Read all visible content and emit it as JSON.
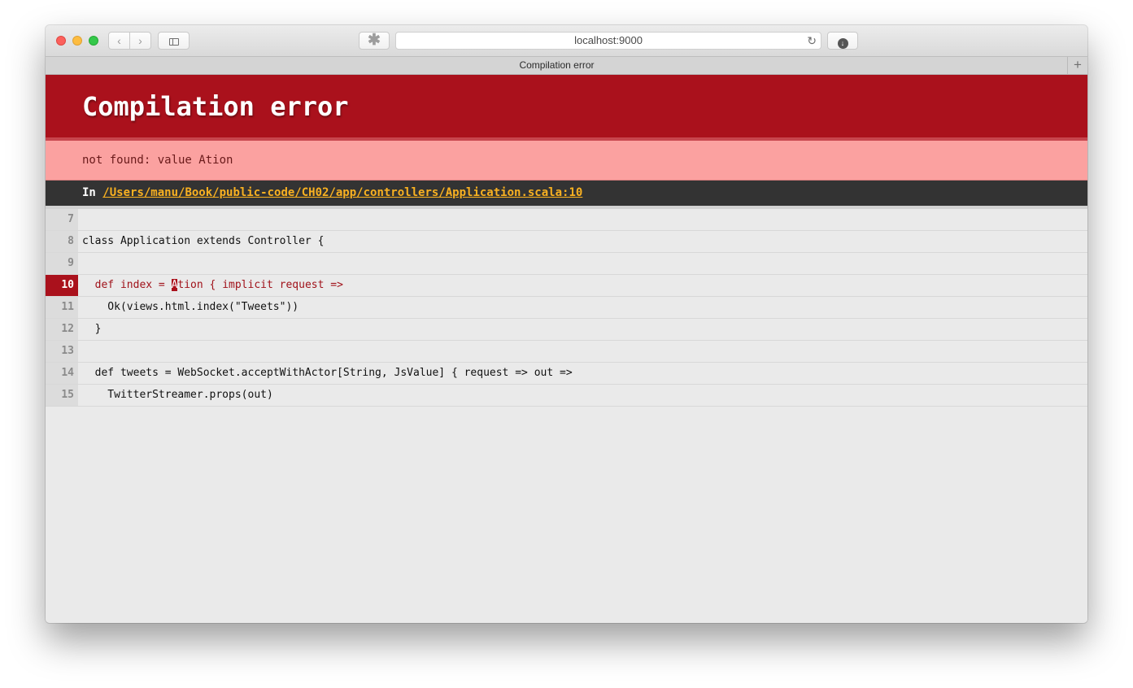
{
  "browser": {
    "url": "localhost:9000",
    "tab_title": "Compilation error",
    "icons": {
      "back": "chevron-left-icon",
      "forward": "chevron-right-icon",
      "sidebar": "sidebar-icon",
      "extension": "puzzle-icon",
      "reload": "reload-icon",
      "download": "download-icon",
      "new_tab": "plus-icon"
    }
  },
  "page": {
    "title": "Compilation error",
    "message": "not found: value Ation",
    "location_prefix": "In",
    "location_path": "/Users/manu/Book/public-code/CH02/app/controllers/Application.scala:10",
    "colors": {
      "header_bg": "#aa111c",
      "message_bg": "#fba1a0",
      "location_bg": "#333333",
      "link": "#f9b121"
    },
    "code_lines": [
      {
        "num": "7",
        "text": ""
      },
      {
        "num": "8",
        "text": "class Application extends Controller {"
      },
      {
        "num": "9",
        "text": ""
      },
      {
        "num": "10",
        "pre": "  def index = ",
        "mark": "A",
        "post": "tion { implicit request =>",
        "error": true
      },
      {
        "num": "11",
        "text": "    Ok(views.html.index(\"Tweets\"))"
      },
      {
        "num": "12",
        "text": "  }"
      },
      {
        "num": "13",
        "text": ""
      },
      {
        "num": "14",
        "text": "  def tweets = WebSocket.acceptWithActor[String, JsValue] { request => out =>"
      },
      {
        "num": "15",
        "text": "    TwitterStreamer.props(out)"
      }
    ]
  }
}
